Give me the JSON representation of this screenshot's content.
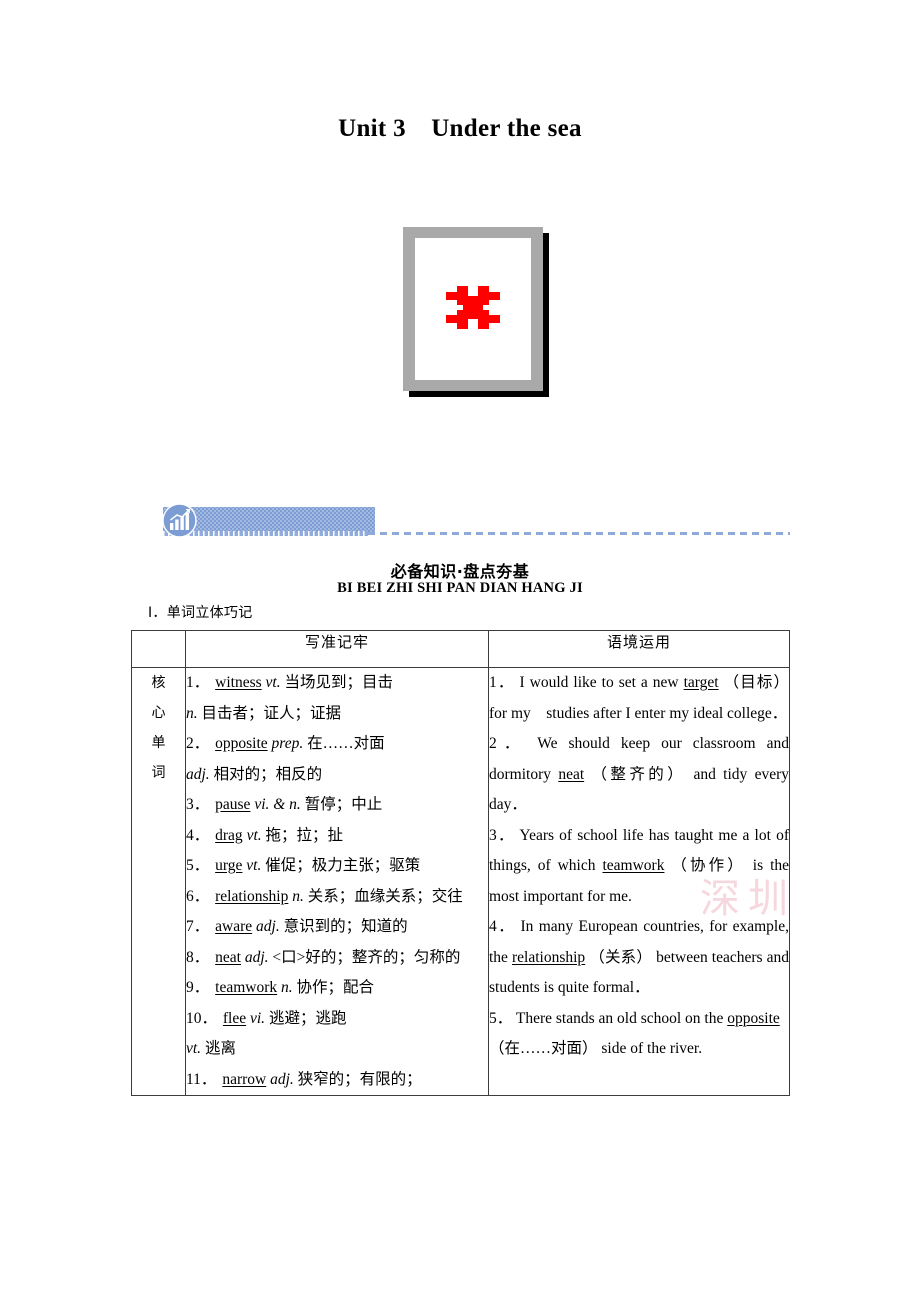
{
  "unit": {
    "title": "Unit 3　Under the sea"
  },
  "figure": {
    "alt_icon": "broken-image-placeholder"
  },
  "banner": {
    "icon": "bar-chart-growth-icon",
    "heading_cn": "必备知识·盘点夯基",
    "heading_pinyin": "BI BEI ZHI SHI PAN DIAN HANG JI"
  },
  "subsection": {
    "label": "Ⅰ．单词立体巧记"
  },
  "watermark": {
    "text": "深圳"
  },
  "table": {
    "headers": {
      "tag": "",
      "left": "写准记牢",
      "right": "语境运用"
    },
    "row_tag": [
      "核",
      "心",
      "单",
      "词"
    ],
    "words": [
      {
        "num": "1．",
        "answer": "witness",
        "tail": "当场见到；目击",
        "pos": "vt.",
        "extra_pos": "n.",
        "extra_tail": "目击者；证人；证据"
      },
      {
        "num": "2．",
        "answer": "opposite",
        "pos": "prep.",
        "tail": "在……对面",
        "extra_pos": "adj.",
        "extra_tail": "相对的；相反的"
      },
      {
        "num": "3．",
        "answer": "pause",
        "pos": "vi. & n.",
        "tail": "暂停；中止"
      },
      {
        "num": "4．",
        "answer": "drag",
        "pos": "vt.",
        "tail": "拖；拉；扯"
      },
      {
        "num": "5．",
        "answer": "urge",
        "pos": "vt.",
        "tail": "催促；极力主张；驱策"
      },
      {
        "num": "6．",
        "answer": "relationship",
        "pos": "n.",
        "tail": "关系；血缘关系；交往"
      },
      {
        "num": "7．",
        "answer": "aware",
        "pos": "adj.",
        "tail": "意识到的；知道的"
      },
      {
        "num": "8．",
        "answer": "neat",
        "pos": "adj.",
        "tail": "<口>好的；整齐的；匀称的"
      },
      {
        "num": "9．",
        "answer": "teamwork",
        "pos": "n.",
        "tail": "协作；配合"
      },
      {
        "num": "10．",
        "answer": "flee",
        "pos": "vi.",
        "tail": "逃避；逃跑",
        "extra_pos": "vt.",
        "extra_tail": "逃离"
      },
      {
        "num": "11．",
        "answer": "narrow",
        "pos": "adj.",
        "tail": "狭窄的；有限的；"
      }
    ],
    "sentences": [
      {
        "num": "1．",
        "before": "I would like to set a new ",
        "answer": "target",
        "gloss": "（目标）",
        "after": " for my　studies after I enter my ideal college．"
      },
      {
        "num": "2．",
        "before": "We should keep our classroom and dormitory ",
        "answer": "neat",
        "gloss": "（整齐的）",
        "after": " and tidy every day．"
      },
      {
        "num": "3．",
        "before": "Years of school life has taught me a lot of things, of which ",
        "answer": "teamwork",
        "gloss": "（协作）",
        "after": " is the most important for me."
      },
      {
        "num": "4．",
        "before": "In many European countries, for example, the ",
        "answer": "relationship",
        "gloss": "（关系）",
        "after": " between teachers and students is quite formal．"
      },
      {
        "num": "5．",
        "before": "There stands an old school on the ",
        "answer": "opposite",
        "gloss": "（在……对面）",
        "after": " side of the river."
      }
    ]
  }
}
